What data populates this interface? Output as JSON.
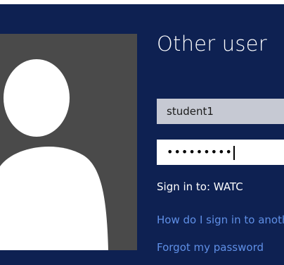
{
  "login": {
    "title": "Other user",
    "username_value": "student1",
    "password_masked": "•••••••••",
    "signin_to": "Sign in to: WATC",
    "help_link": "How do I sign in to another domain?",
    "forgot_link": "Forgot my password"
  },
  "icons": {
    "avatar": "user-silhouette-icon"
  },
  "colors": {
    "background": "#0e2152",
    "avatar_tile": "#4a4a4a",
    "username_field": "#c6c9d3",
    "link": "#5f8fe6"
  }
}
